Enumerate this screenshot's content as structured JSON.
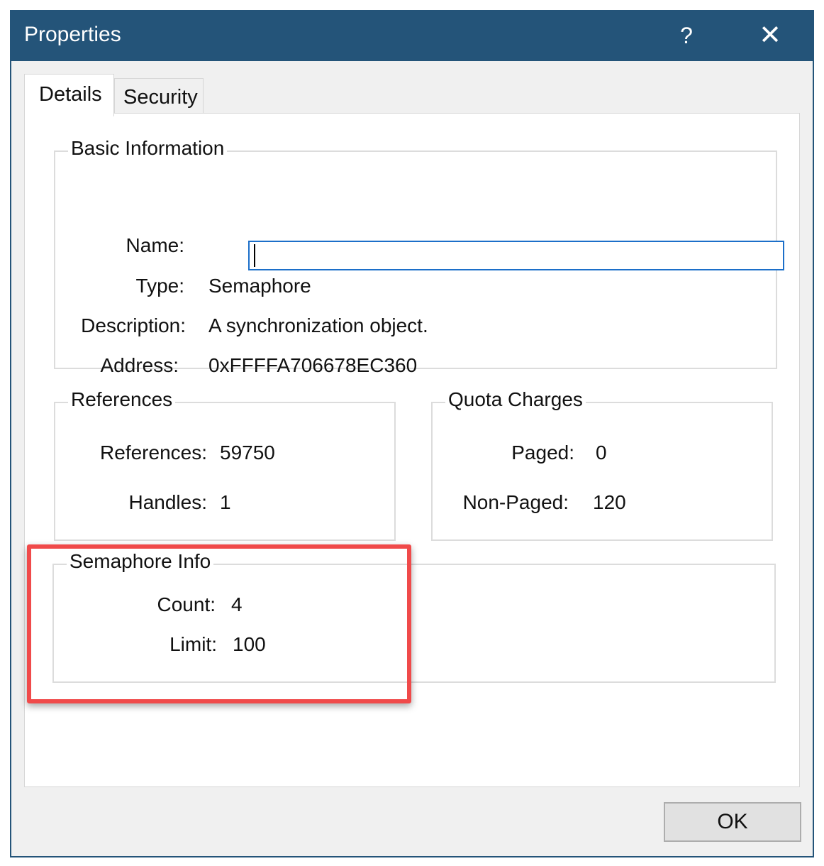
{
  "window": {
    "title": "Properties",
    "help_label": "?",
    "close_label": "✕"
  },
  "tabs": [
    {
      "label": "Details"
    },
    {
      "label": "Security"
    }
  ],
  "basic_info": {
    "title": "Basic Information",
    "name_label": "Name:",
    "name_value": "",
    "type_label": "Type:",
    "type_value": "Semaphore",
    "description_label": "Description:",
    "description_value": "A synchronization object.",
    "address_label": "Address:",
    "address_value": "0xFFFFA706678EC360"
  },
  "references": {
    "title": "References",
    "references_label": "References:",
    "references_value": "59750",
    "handles_label": "Handles:",
    "handles_value": "1"
  },
  "quota": {
    "title": "Quota Charges",
    "paged_label": "Paged:",
    "paged_value": "0",
    "nonpaged_label": "Non-Paged:",
    "nonpaged_value": "120"
  },
  "semaphore": {
    "title": "Semaphore Info",
    "count_label": "Count:",
    "count_value": "4",
    "limit_label": "Limit:",
    "limit_value": "100"
  },
  "buttons": {
    "ok_label": "OK"
  },
  "colors": {
    "titlebar": "#245479",
    "highlight": "#f04a4a",
    "input_focus": "#1c6fc9"
  }
}
